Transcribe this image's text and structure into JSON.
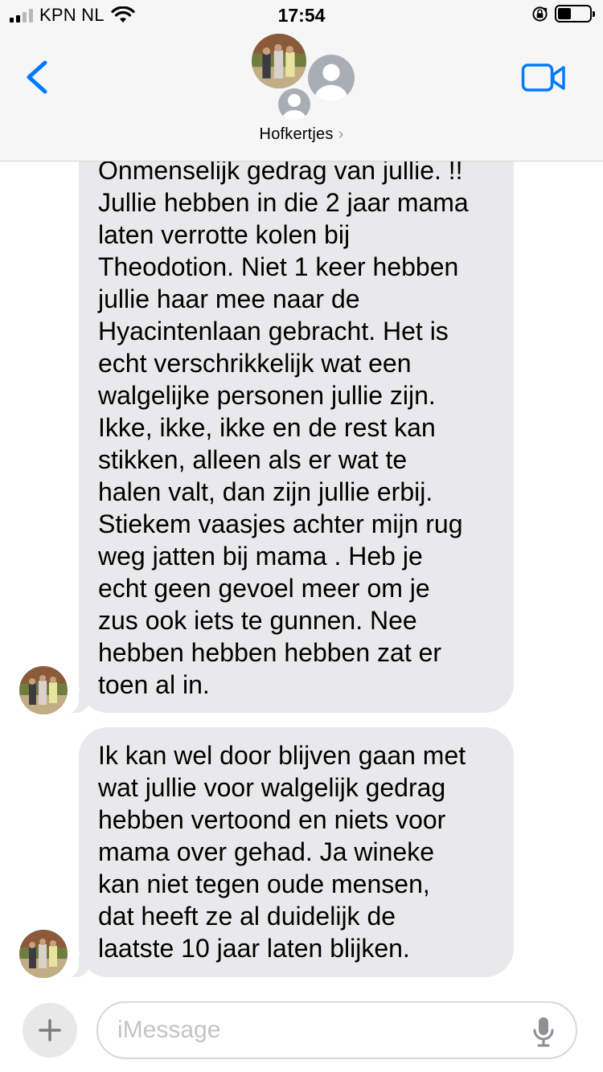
{
  "status_bar": {
    "carrier": "KPN NL",
    "time": "17:54",
    "signal_bars": 4,
    "signal_bars_filled": 2,
    "battery_level": 0.35,
    "icons": [
      "cellular-signal-icon",
      "wifi-icon",
      "orientation-lock-icon",
      "battery-icon"
    ]
  },
  "header": {
    "back_icon": "chevron-left-icon",
    "group_name": "Hofkertjes",
    "group_chevron": "›",
    "video_icon": "video-camera-icon",
    "accent_color": "#007aff"
  },
  "messages": [
    {
      "sender_avatar": "photo-avatar",
      "direction": "incoming",
      "text": "Onmenselijk gedrag van jullie. !!\nJullie hebben in die 2 jaar mama\nlaten verrotte kolen bij\nTheodotion. Niet 1 keer hebben\njullie haar mee naar de\nHyacintenlaan gebracht. Het is\necht verschrikkelijk wat een\nwalgelijke personen jullie zijn.\nIkke, ikke, ikke en de rest kan\nstikken, alleen als er wat te\nhalen valt, dan zijn jullie erbij.\nStiekem vaasjes achter mijn rug\nweg jatten bij mama . Heb je\necht geen gevoel meer om je\nzus ook iets te gunnen. Nee\nhebben hebben hebben zat er\ntoen al in."
    },
    {
      "sender_avatar": "photo-avatar",
      "direction": "incoming",
      "text": "Ik kan wel door blijven gaan met\nwat jullie voor walgelijk gedrag\nhebben vertoond en niets voor\nmama over gehad. Ja wineke\nkan niet tegen oude mensen,\ndat heeft ze al duidelijk de\nlaatste 10 jaar laten blijken."
    }
  ],
  "compose": {
    "plus_icon": "plus-icon",
    "placeholder": "iMessage",
    "value": "",
    "mic_icon": "microphone-icon"
  },
  "colors": {
    "incoming_bubble": "#e9e9eb",
    "header_bg": "#f6f6f6",
    "accent": "#007aff"
  }
}
